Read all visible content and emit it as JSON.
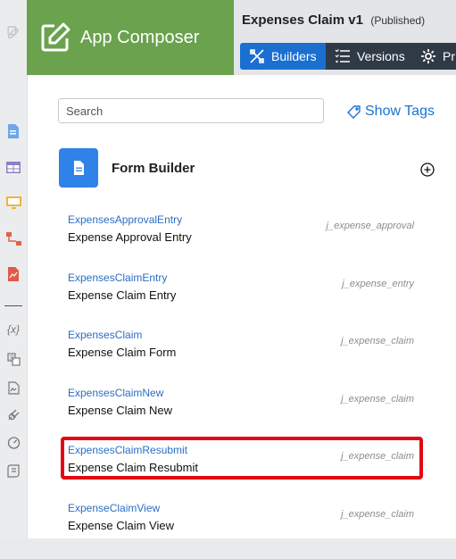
{
  "brand": {
    "title": "App Composer",
    "icon": "edit-icon",
    "color": "#6aa24d"
  },
  "header": {
    "app_name": "Expenses Claim v1",
    "status": "(Published)",
    "tabs": [
      {
        "label": "Builders",
        "icon": "builders-icon",
        "active": true
      },
      {
        "label": "Versions",
        "icon": "versions-icon",
        "active": false
      },
      {
        "label": "Pr",
        "icon": "gear-icon",
        "active": false
      }
    ]
  },
  "search": {
    "placeholder": "Search",
    "value": ""
  },
  "show_tags": {
    "label": "Show Tags",
    "icon": "tag-icon"
  },
  "section": {
    "title": "Form Builder",
    "icon": "document-icon",
    "add_icon": "plus-circle-icon"
  },
  "forms": [
    {
      "code": "ExpensesApprovalEntry",
      "label": "Expense Approval Entry",
      "table": "j_expense_approval"
    },
    {
      "code": "ExpensesClaimEntry",
      "label": "Expense Claim Entry",
      "table": "j_expense_entry"
    },
    {
      "code": "ExpensesClaim",
      "label": "Expense Claim Form",
      "table": "j_expense_claim"
    },
    {
      "code": "ExpensesClaimNew",
      "label": "Expense Claim New",
      "table": "j_expense_claim"
    },
    {
      "code": "ExpensesClaimResubmit",
      "label": "Expense Claim Resubmit",
      "table": "j_expense_claim",
      "highlighted": true
    },
    {
      "code": "ExpenseClaimView",
      "label": "Expense Claim View",
      "table": "j_expense_claim"
    }
  ],
  "left_rail": [
    "edit-icon",
    "form-icon",
    "datalist-icon",
    "userview-icon",
    "process-icon",
    "report-icon",
    "variable-icon",
    "translate-icon",
    "document-icon",
    "plugin-icon",
    "performance-icon",
    "log-icon"
  ],
  "colors": {
    "accent_blue": "#1a6fd0",
    "highlight_red": "#e30613",
    "tab_dark": "#2f3a46"
  }
}
